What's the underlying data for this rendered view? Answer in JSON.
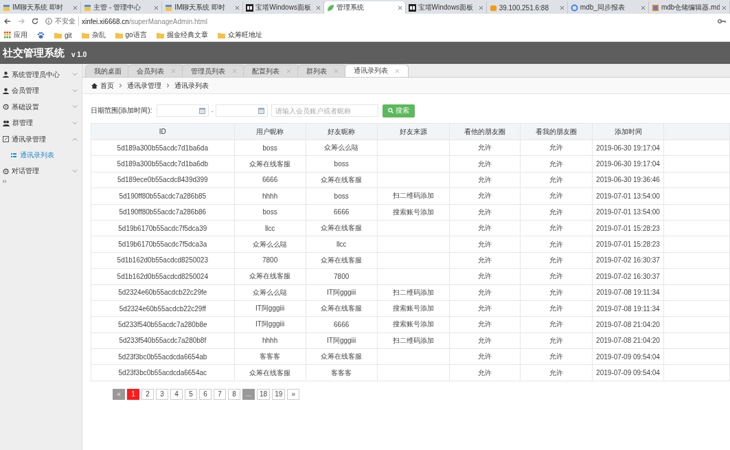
{
  "browser": {
    "tabs": [
      {
        "title": "IM聊天系统 即时",
        "kind": "page",
        "selected": false
      },
      {
        "title": "主管 - 管理中心",
        "kind": "page",
        "selected": false
      },
      {
        "title": "IM聊天系统 即时",
        "kind": "page",
        "selected": false
      },
      {
        "title": "宝塔Windows面板",
        "kind": "panel",
        "selected": false
      },
      {
        "title": "管理系统",
        "kind": "leaf",
        "selected": true
      },
      {
        "title": "宝塔Windows面板",
        "kind": "panel",
        "selected": false
      },
      {
        "title": "39.100.251.6:88",
        "kind": "db",
        "selected": false
      },
      {
        "title": "mdb_同步报表",
        "kind": "gear",
        "selected": false
      },
      {
        "title": "mdb仓储编辑器.md",
        "kind": "doc",
        "selected": false
      }
    ],
    "security": "不安全",
    "url_host": "xinfei.xi6668.cn",
    "url_path": "/superManageAdmin.html",
    "bookmarks": [
      {
        "label": "应用",
        "kind": "apps"
      },
      {
        "kind": "paw"
      },
      {
        "label": "git",
        "kind": "folder"
      },
      {
        "label": "杂乱",
        "kind": "folder"
      },
      {
        "label": "go语言",
        "kind": "folder"
      },
      {
        "label": "掘金经典文章",
        "kind": "folder"
      },
      {
        "label": "众筹旺地址",
        "kind": "folder"
      }
    ]
  },
  "app": {
    "title": "社交管理系统",
    "version": "v 1.0"
  },
  "sidebar": {
    "items": [
      {
        "label": "系统管理员中心",
        "expanded": false
      },
      {
        "label": "会员管理",
        "expanded": false
      },
      {
        "label": "基础设置",
        "expanded": false
      },
      {
        "label": "群管理",
        "expanded": false
      },
      {
        "label": "通讯录管理",
        "expanded": true,
        "children": [
          {
            "label": "通讯录列表",
            "selected": true
          }
        ]
      },
      {
        "label": "对话管理",
        "expanded": false
      }
    ]
  },
  "tabs": [
    {
      "label": "我的桌面",
      "closable": false,
      "selected": false
    },
    {
      "label": "会员列表",
      "closable": true,
      "selected": false
    },
    {
      "label": "管理员列表",
      "closable": true,
      "selected": false
    },
    {
      "label": "配置列表",
      "closable": true,
      "selected": false
    },
    {
      "label": "群列表",
      "closable": true,
      "selected": false
    },
    {
      "label": "通讯录列表",
      "closable": true,
      "selected": true
    }
  ],
  "breadcrumb": [
    "首页",
    "通讯录管理",
    "通讯录列表"
  ],
  "filter": {
    "label": "日期范围(添加时间):",
    "separator": "-",
    "placeholder": "请输入会员账户或者昵称",
    "button": "搜索"
  },
  "table": {
    "columns": [
      "ID",
      "用户昵称",
      "好友昵称",
      "好友来源",
      "看他的朋友圈",
      "看我的朋友圈",
      "添加时间"
    ],
    "rows": [
      [
        "5d189a300b55acdc7d1ba6da",
        "boss",
        "众筹么么哒",
        "",
        "允许",
        "允许",
        "2019-06-30 19:17:04"
      ],
      [
        "5d189a300b55acdc7d1ba6db",
        "众筹在线客服",
        "boss",
        "",
        "允许",
        "允许",
        "2019-06-30 19:17:04"
      ],
      [
        "5d189ece0b55acdc8439d399",
        "6666",
        "众筹在线客服",
        "",
        "允许",
        "允许",
        "2019-06-30 19:36:46"
      ],
      [
        "5d190ff80b55acdc7a286b85",
        "hhhh",
        "boss",
        "扫二维码添加",
        "允许",
        "允许",
        "2019-07-01 13:54:00"
      ],
      [
        "5d190ff80b55acdc7a286b86",
        "boss",
        "6666",
        "搜索账号添加",
        "允许",
        "允许",
        "2019-07-01 13:54:00"
      ],
      [
        "5d19b6170b55acdc7f5dca39",
        "llcc",
        "众筹在线客服",
        "",
        "允许",
        "允许",
        "2019-07-01 15:28:23"
      ],
      [
        "5d19b6170b55acdc7f5dca3a",
        "众筹么么哒",
        "llcc",
        "",
        "允许",
        "允许",
        "2019-07-01 15:28:23"
      ],
      [
        "5d1b162d0b55acdcd8250023",
        "7800",
        "众筹在线客服",
        "",
        "允许",
        "允许",
        "2019-07-02 16:30:37"
      ],
      [
        "5d1b162d0b55acdcd8250024",
        "众筹在线客服",
        "7800",
        "",
        "允许",
        "允许",
        "2019-07-02 16:30:37"
      ],
      [
        "5d2324e60b55acdcb22c29fe",
        "众筹么么哒",
        "IT阿gggiii",
        "扫二维码添加",
        "允许",
        "允许",
        "2019-07-08 19:11:34"
      ],
      [
        "5d2324e60b55acdcb22c29ff",
        "IT阿gggiii",
        "众筹在线客服",
        "搜索账号添加",
        "允许",
        "允许",
        "2019-07-08 19:11:34"
      ],
      [
        "5d233f540b55acdc7a280b8e",
        "IT阿gggiii",
        "6666",
        "搜索账号添加",
        "允许",
        "允许",
        "2019-07-08 21:04:20"
      ],
      [
        "5d233f540b55acdc7a280b8f",
        "hhhh",
        "IT阿gggiii",
        "扫二维码添加",
        "允许",
        "允许",
        "2019-07-08 21:04:20"
      ],
      [
        "5d23f3bc0b55acdcda6654ab",
        "客客客",
        "众筹在线客服",
        "",
        "允许",
        "允许",
        "2019-07-09 09:54:04"
      ],
      [
        "5d23f3bc0b55acdcda6654ac",
        "众筹在线客服",
        "客客客",
        "",
        "允许",
        "允许",
        "2019-07-09 09:54:04"
      ]
    ]
  },
  "pagination": [
    {
      "label": "«",
      "disabled": true,
      "selected": false
    },
    {
      "label": "1",
      "disabled": false,
      "selected": true
    },
    {
      "label": "2",
      "disabled": false,
      "selected": false
    },
    {
      "label": "3",
      "disabled": false,
      "selected": false
    },
    {
      "label": "4",
      "disabled": false,
      "selected": false
    },
    {
      "label": "5",
      "disabled": false,
      "selected": false
    },
    {
      "label": "6",
      "disabled": false,
      "selected": false
    },
    {
      "label": "7",
      "disabled": false,
      "selected": false
    },
    {
      "label": "8",
      "disabled": false,
      "selected": false
    },
    {
      "label": "...",
      "disabled": true,
      "selected": false
    },
    {
      "label": "18",
      "disabled": false,
      "selected": false
    },
    {
      "label": "19",
      "disabled": false,
      "selected": false
    },
    {
      "label": "»",
      "disabled": false,
      "selected": false
    }
  ]
}
